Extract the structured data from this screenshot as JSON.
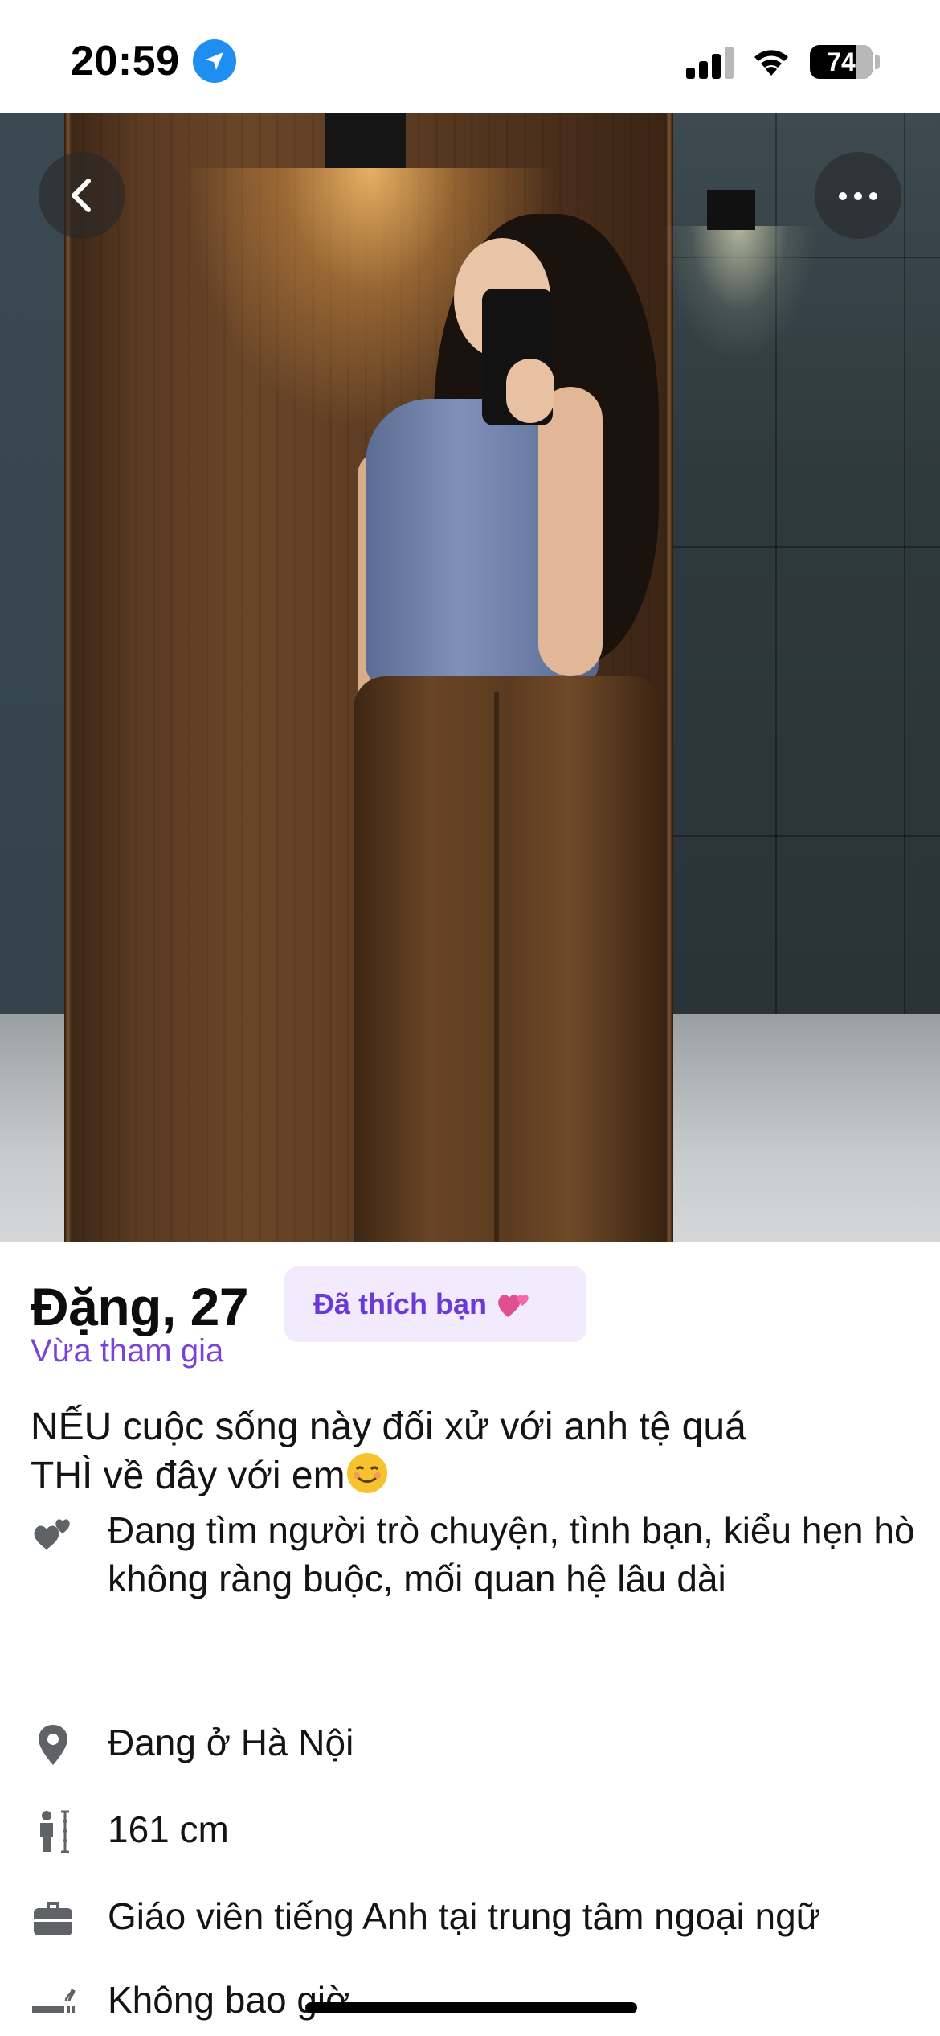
{
  "status_bar": {
    "time": "20:59",
    "battery": "74",
    "location_icon": "location-arrow-icon",
    "signal_icon": "cellular-signal-icon",
    "wifi_icon": "wifi-icon"
  },
  "photo": {
    "back_icon": "chevron-left-icon",
    "more_icon": "more-horizontal-icon"
  },
  "profile": {
    "name_age": "Đặng, 27",
    "liked_badge": "Đã thích bạn",
    "liked_badge_icon": "two-hearts-icon",
    "joined": "Vừa tham gia",
    "bio_line1": "NẾU cuộc sống này đối xử với anh tệ quá",
    "bio_line2": "THÌ về đây với em",
    "bio_emoji": "smiling-face-icon",
    "details": [
      {
        "icon": "hearts-icon",
        "text": "Đang tìm người trò chuyện, tình bạn, kiểu hẹn hò không ràng buộc, mối quan hệ lâu dài"
      },
      {
        "icon": "location-pin-icon",
        "text": "Đang ở Hà Nội"
      },
      {
        "icon": "height-icon",
        "text": "161 cm"
      },
      {
        "icon": "briefcase-icon",
        "text": "Giáo viên tiếng Anh tại trung tâm ngoại ngữ"
      },
      {
        "icon": "smoking-icon",
        "text": "Không bao giờ"
      }
    ]
  },
  "colors": {
    "accent_purple": "#7a43d8",
    "badge_bg": "#f1ebfd",
    "badge_text": "#6a3ad6",
    "text": "#141414",
    "icon_gray": "#5f6368",
    "location_blue": "#1f8ef1"
  }
}
